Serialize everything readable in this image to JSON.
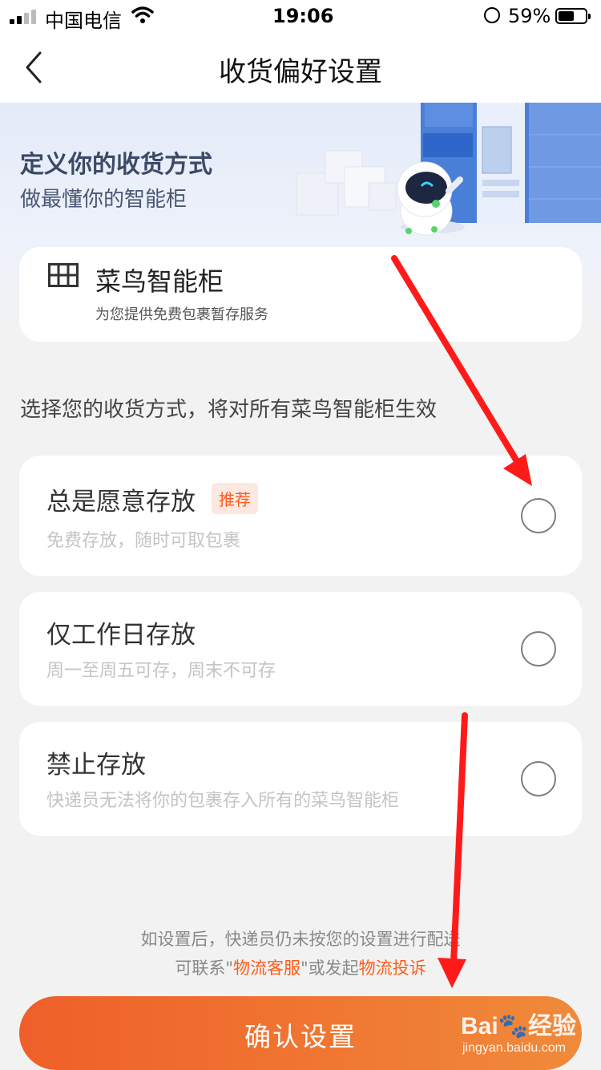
{
  "status_bar": {
    "carrier": "中国电信",
    "time": "19:06",
    "battery_percent": "59%",
    "battery_level": 0.59,
    "icons": [
      "signal-icon",
      "wifi-icon",
      "rotation-lock-icon",
      "battery-icon"
    ]
  },
  "nav": {
    "title": "收货偏好设置",
    "back_icon": "chevron-left-icon"
  },
  "hero": {
    "title": "定义你的收货方式",
    "subtitle": "做最懂你的智能柜"
  },
  "cabinet_card": {
    "icon": "grid-cabinet-icon",
    "title": "菜鸟智能柜",
    "subtitle": "为您提供免费包裹暂存服务"
  },
  "section_label": "选择您的收货方式，将对所有菜鸟智能柜生效",
  "options": [
    {
      "title": "总是愿意存放",
      "badge": "推荐",
      "desc": "免费存放，随时可取包裹",
      "selected": false
    },
    {
      "title": "仅工作日存放",
      "desc": "周一至周五可存，周末不可存",
      "selected": false
    },
    {
      "title": "禁止存放",
      "desc": "快递员无法将你的包裹存入所有的菜鸟智能柜",
      "selected": false
    }
  ],
  "footer": {
    "line1": "如设置后，快递员仍未按您的设置进行配送",
    "line2_prefix": "可联系\"",
    "link_service": "物流客服",
    "line2_middle": "\"或发起",
    "link_complaint": "物流投诉"
  },
  "confirm_button": {
    "label": "确认设置"
  },
  "watermark": {
    "logo": "Bai🐾经验",
    "url": "jingyan.baidu.com"
  },
  "colors": {
    "accent": "#ff5c1a",
    "button_start": "#ef5f29",
    "button_end": "#f08a3a",
    "annotation_arrow": "#ff1a1a",
    "page_bg": "#f2f2f2"
  }
}
